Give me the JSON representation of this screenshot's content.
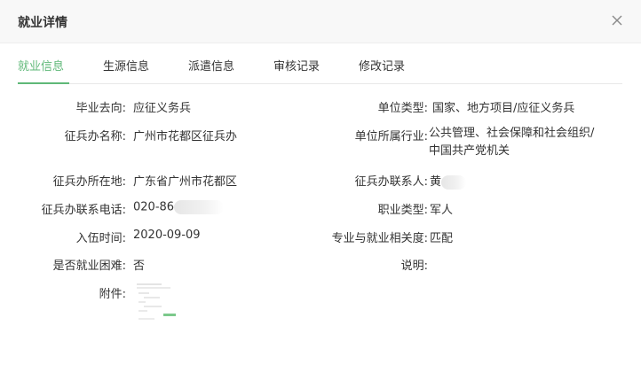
{
  "dialog": {
    "title": "就业详情"
  },
  "tabs": [
    {
      "label": "就业信息",
      "active": true
    },
    {
      "label": "生源信息"
    },
    {
      "label": "派遣信息"
    },
    {
      "label": "审核记录"
    },
    {
      "label": "修改记录"
    }
  ],
  "fields": {
    "destination": {
      "label": "毕业去向:",
      "value": "应征义务兵"
    },
    "unit_type": {
      "label": "单位类型:",
      "value": "国家、地方项目/应征义务兵"
    },
    "office_name": {
      "label": "征兵办名称:",
      "value": "广州市花都区征兵办"
    },
    "industry": {
      "label": "单位所属行业:",
      "value": "公共管理、社会保障和社会组织/中国共产党机关"
    },
    "office_location": {
      "label": "征兵办所在地:",
      "value": "广东省广州市花都区"
    },
    "contact_person": {
      "label": "征兵办联系人:",
      "value": "黄"
    },
    "contact_phone": {
      "label": "征兵办联系电话:",
      "value": "020-86"
    },
    "job_type": {
      "label": "职业类型:",
      "value": "军人"
    },
    "enlist_date": {
      "label": "入伍时间:",
      "value": "2020-09-09"
    },
    "relevance": {
      "label": "专业与就业相关度:",
      "value": "匹配"
    },
    "hardship": {
      "label": "是否就业困难:",
      "value": "否"
    },
    "note": {
      "label": "说明:",
      "value": ""
    },
    "attachment": {
      "label": "附件:"
    }
  },
  "colors": {
    "accent": "#5fb878",
    "header_bg": "#f8f8f8"
  },
  "icons": {
    "close": "close-icon",
    "attachment": "document-thumbnail-icon"
  }
}
